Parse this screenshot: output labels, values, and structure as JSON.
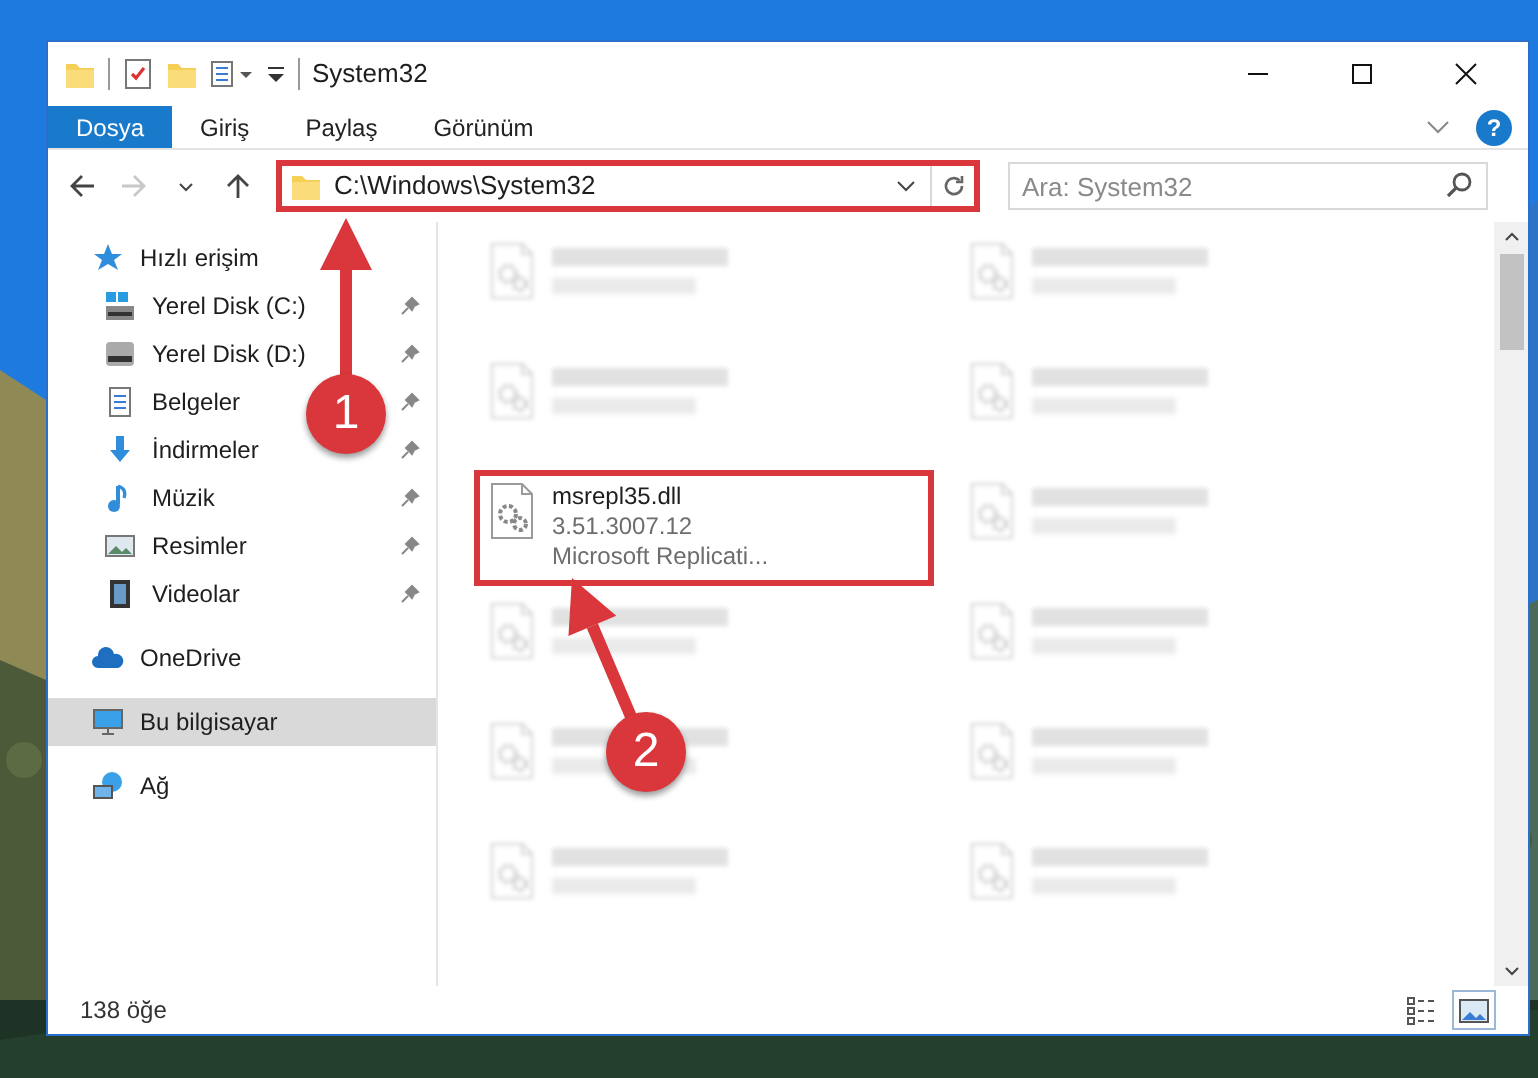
{
  "window": {
    "title": "System32"
  },
  "ribbon": {
    "tabs": [
      {
        "label": "Dosya",
        "kind": "file",
        "selected": false
      },
      {
        "label": "Giriş",
        "kind": "tab",
        "selected": false
      },
      {
        "label": "Paylaş",
        "kind": "tab",
        "selected": false
      },
      {
        "label": "Görünüm",
        "kind": "tab",
        "selected": false
      }
    ],
    "help": "?"
  },
  "navigation": {
    "forward_disabled": true
  },
  "address_bar": {
    "path": "C:\\Windows\\System32",
    "highlighted": true
  },
  "search": {
    "placeholder": "Ara: System32"
  },
  "sidebar": {
    "items": [
      {
        "label": "Hızlı erişim",
        "kind": "quick-access",
        "selected": false,
        "children": [
          {
            "label": "Yerel Disk (C:)",
            "kind": "system-drive",
            "pinned": true,
            "selected": false
          },
          {
            "label": "Yerel Disk (D:)",
            "kind": "drive",
            "pinned": true,
            "selected": false
          },
          {
            "label": "Belgeler",
            "kind": "documents",
            "pinned": true,
            "selected": false
          },
          {
            "label": "İndirmeler",
            "kind": "downloads",
            "pinned": true,
            "selected": false
          },
          {
            "label": "Müzik",
            "kind": "music",
            "pinned": true,
            "selected": false
          },
          {
            "label": "Resimler",
            "kind": "pictures",
            "pinned": true,
            "selected": false
          },
          {
            "label": "Videolar",
            "kind": "videos",
            "pinned": true,
            "selected": false
          }
        ]
      },
      {
        "label": "OneDrive",
        "kind": "cloud",
        "selected": false
      },
      {
        "label": "Bu bilgisayar",
        "kind": "computer",
        "selected": true
      },
      {
        "label": "Ağ",
        "kind": "network",
        "selected": false
      }
    ]
  },
  "files": [
    {
      "kind": "blurred"
    },
    {
      "kind": "blurred"
    },
    {
      "kind": "blurred"
    },
    {
      "kind": "blurred"
    },
    {
      "kind": "file",
      "name": "msrepl35.dll",
      "line_2": "3.51.3007.12",
      "line_3": "Microsoft Replicati...",
      "highlighted": true
    },
    {
      "kind": "blurred"
    },
    {
      "kind": "blurred"
    },
    {
      "kind": "blurred"
    },
    {
      "kind": "blurred"
    },
    {
      "kind": "blurred"
    },
    {
      "kind": "blurred"
    },
    {
      "kind": "blurred"
    }
  ],
  "status_bar": {
    "item_count": "138 öğe",
    "views": [
      {
        "kind": "details",
        "selected": false
      },
      {
        "kind": "tiles",
        "selected": true
      }
    ]
  },
  "annotations": [
    {
      "number": "1"
    },
    {
      "number": "2"
    }
  ]
}
